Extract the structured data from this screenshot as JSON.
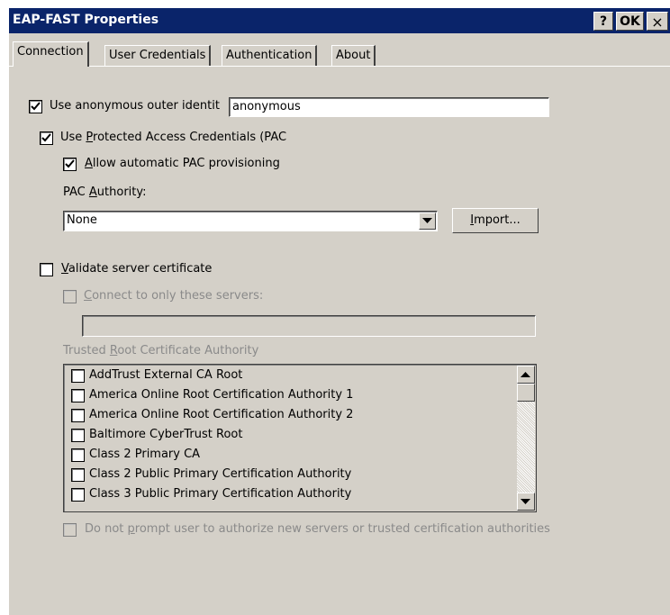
{
  "window": {
    "title": "EAP-FAST Properties",
    "help_label": "?",
    "ok_label": "OK",
    "close_label": "×"
  },
  "tabs": [
    {
      "label": "Connection",
      "active": true
    },
    {
      "label": "User Credentials",
      "active": false
    },
    {
      "label": "Authentication",
      "active": false
    },
    {
      "label": "About",
      "active": false
    }
  ],
  "connection": {
    "anon_identity": {
      "label": "Use anonymous outer identit",
      "checked": true,
      "value": "anonymous"
    },
    "use_pac": {
      "label_pre": "Use ",
      "label_u": "P",
      "label_post": "rotected Access Credentials (PAC",
      "checked": true
    },
    "auto_pac": {
      "label_u": "A",
      "label_post": "llow automatic PAC provisioning",
      "checked": true
    },
    "pac_authority": {
      "label_pre": "PAC ",
      "label_u": "A",
      "label_post": "uthority:",
      "selected": "None"
    },
    "import_button": {
      "label_u": "I",
      "label_post": "mport..."
    },
    "validate_cert": {
      "label_u": "V",
      "label_post": "alidate server certificate",
      "checked": false
    },
    "connect_only": {
      "label_u": "C",
      "label_post": "onnect to only these servers:",
      "checked": false,
      "enabled": false,
      "value": ""
    },
    "trusted_root": {
      "label_pre": "Trusted ",
      "label_u": "R",
      "label_post": "oot Certificate Authority"
    },
    "ca_list": [
      "AddTrust External CA Root",
      "America Online Root Certification Authority 1",
      "America Online Root Certification Authority 2",
      "Baltimore CyberTrust Root",
      "Class 2 Primary CA",
      "Class 2 Public Primary Certification Authority",
      "Class 3 Public Primary Certification Authority"
    ],
    "no_prompt": {
      "label_pre": "Do not ",
      "label_u": "p",
      "label_post": "rompt user to authorize new servers or trusted certification authorities",
      "checked": false,
      "enabled": false
    }
  },
  "colors": {
    "titlebar": "#0a246a",
    "face": "#d4d0c8",
    "disabled_text": "#8a8a8a"
  }
}
